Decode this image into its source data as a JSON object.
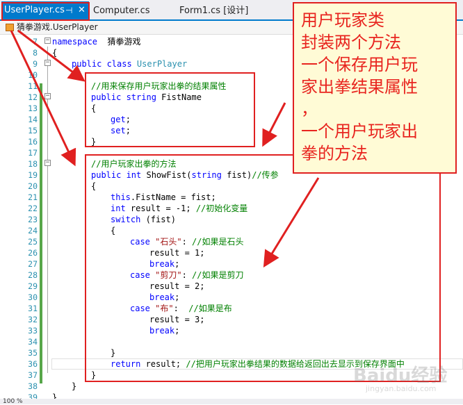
{
  "tabs": [
    {
      "label": "UserPlayer.cs",
      "active": true,
      "pin": "⊣",
      "close": "✕"
    },
    {
      "label": "Computer.cs",
      "active": false
    },
    {
      "label": "Form1.cs [设计]",
      "active": false
    }
  ],
  "navbar": {
    "path": "猜拳游戏.UserPlayer"
  },
  "editor": {
    "first_line": 7,
    "lines": [
      {
        "n": 7,
        "indent": 0,
        "parts": [
          [
            "kw",
            "namespace"
          ],
          [
            "",
            "  猜拳游戏"
          ]
        ]
      },
      {
        "n": 8,
        "indent": 0,
        "parts": [
          [
            "",
            "{"
          ]
        ]
      },
      {
        "n": 9,
        "indent": 1,
        "parts": [
          [
            "kw",
            "public class "
          ],
          [
            "cls",
            "UserPlayer"
          ]
        ]
      },
      {
        "n": 10,
        "indent": 1,
        "parts": [
          [
            "",
            "{"
          ]
        ]
      },
      {
        "n": 11,
        "indent": 2,
        "parts": [
          [
            "cmt",
            "//用来保存用户玩家出拳的结果属性"
          ]
        ]
      },
      {
        "n": 12,
        "indent": 2,
        "parts": [
          [
            "kw",
            "public string "
          ],
          [
            "",
            "FistName"
          ]
        ]
      },
      {
        "n": 13,
        "indent": 2,
        "parts": [
          [
            "",
            "{"
          ]
        ]
      },
      {
        "n": 14,
        "indent": 3,
        "parts": [
          [
            "kw",
            "get"
          ],
          [
            "",
            ";"
          ]
        ]
      },
      {
        "n": 15,
        "indent": 3,
        "parts": [
          [
            "kw",
            "set"
          ],
          [
            "",
            ";"
          ]
        ]
      },
      {
        "n": 16,
        "indent": 2,
        "parts": [
          [
            "",
            "}"
          ]
        ]
      },
      {
        "n": 17,
        "indent": 0,
        "parts": []
      },
      {
        "n": 18,
        "indent": 2,
        "parts": [
          [
            "cmt",
            "//用户玩家出拳的方法"
          ]
        ]
      },
      {
        "n": 19,
        "indent": 2,
        "parts": [
          [
            "kw",
            "public int "
          ],
          [
            "",
            "ShowFist("
          ],
          [
            "kw",
            "string "
          ],
          [
            "",
            "fist)"
          ],
          [
            "cmt",
            "//传参"
          ]
        ]
      },
      {
        "n": 20,
        "indent": 2,
        "parts": [
          [
            "",
            "{"
          ]
        ]
      },
      {
        "n": 21,
        "indent": 3,
        "parts": [
          [
            "kw",
            "this"
          ],
          [
            "",
            ".FistName = fist;"
          ]
        ]
      },
      {
        "n": 22,
        "indent": 3,
        "parts": [
          [
            "kw",
            "int "
          ],
          [
            "",
            "result = -1; "
          ],
          [
            "cmt",
            "//初始化变量"
          ]
        ]
      },
      {
        "n": 23,
        "indent": 3,
        "parts": [
          [
            "kw",
            "switch "
          ],
          [
            "",
            "(fist)"
          ]
        ]
      },
      {
        "n": 24,
        "indent": 3,
        "parts": [
          [
            "",
            "{"
          ]
        ]
      },
      {
        "n": 25,
        "indent": 4,
        "parts": [
          [
            "kw",
            "case "
          ],
          [
            "str",
            "\"石头\""
          ],
          [
            "",
            ": "
          ],
          [
            "cmt",
            "//如果是石头"
          ]
        ]
      },
      {
        "n": 26,
        "indent": 5,
        "parts": [
          [
            "",
            "result = 1;"
          ]
        ]
      },
      {
        "n": 27,
        "indent": 5,
        "parts": [
          [
            "kw",
            "break"
          ],
          [
            "",
            ";"
          ]
        ]
      },
      {
        "n": 28,
        "indent": 4,
        "parts": [
          [
            "kw",
            "case "
          ],
          [
            "str",
            "\"剪刀\""
          ],
          [
            "",
            ": "
          ],
          [
            "cmt",
            "//如果是剪刀"
          ]
        ]
      },
      {
        "n": 29,
        "indent": 5,
        "parts": [
          [
            "",
            "result = 2;"
          ]
        ]
      },
      {
        "n": 30,
        "indent": 5,
        "parts": [
          [
            "kw",
            "break"
          ],
          [
            "",
            ";"
          ]
        ]
      },
      {
        "n": 31,
        "indent": 4,
        "parts": [
          [
            "kw",
            "case "
          ],
          [
            "str",
            "\"布\""
          ],
          [
            "",
            ":  "
          ],
          [
            "cmt",
            "//如果是布"
          ]
        ]
      },
      {
        "n": 32,
        "indent": 5,
        "parts": [
          [
            "",
            "result = 3;"
          ]
        ]
      },
      {
        "n": 33,
        "indent": 5,
        "parts": [
          [
            "kw",
            "break"
          ],
          [
            "",
            ";"
          ]
        ]
      },
      {
        "n": 34,
        "indent": 0,
        "parts": []
      },
      {
        "n": 35,
        "indent": 3,
        "parts": [
          [
            "",
            "}"
          ]
        ]
      },
      {
        "n": 36,
        "indent": 3,
        "parts": [
          [
            "kw",
            "return "
          ],
          [
            "",
            "result; "
          ],
          [
            "cmt",
            "//把用户玩家出拳结果的数据给返回出去显示到保存界面中"
          ]
        ]
      },
      {
        "n": 37,
        "indent": 2,
        "parts": [
          [
            "",
            "}"
          ]
        ]
      },
      {
        "n": 38,
        "indent": 1,
        "parts": [
          [
            "",
            "}"
          ]
        ]
      },
      {
        "n": 39,
        "indent": 0,
        "parts": [
          [
            "",
            "}"
          ]
        ]
      }
    ]
  },
  "statusbar": {
    "zoom": "100 %"
  },
  "callout": {
    "lines": [
      "用户玩家类",
      "封装两个方法",
      "一个保存用户玩",
      "家出拳结果属性",
      "，",
      "一个用户玩家出",
      "拳的方法"
    ]
  },
  "watermark": {
    "text": "Baidu经验",
    "sub": "jingyan.baidu.com"
  },
  "colors": {
    "accent": "#007acc",
    "annotation": "#e02020",
    "callout_bg": "#fffbd6"
  }
}
